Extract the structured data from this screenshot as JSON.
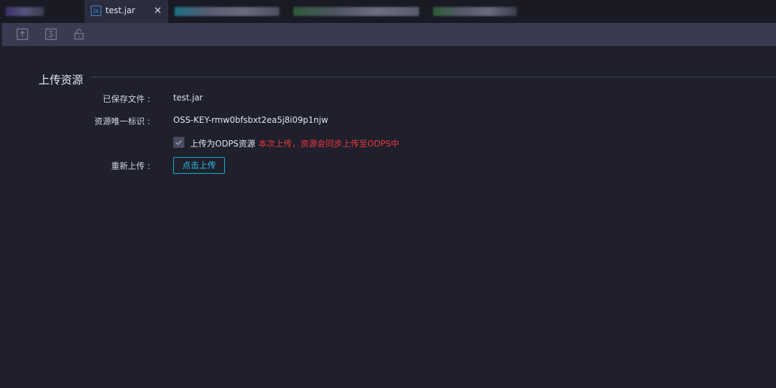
{
  "tabs": {
    "active": {
      "title": "test.jar",
      "icon_text": "Ja",
      "close_glyph": "×"
    }
  },
  "toolbar": {
    "icons": [
      "upload-icon",
      "version-icon",
      "unlock-icon"
    ]
  },
  "section": {
    "title": "上传资源"
  },
  "form": {
    "saved_file_label": "已保存文件 :",
    "saved_file_value": "test.jar",
    "resource_id_label": "资源唯一标识 :",
    "resource_id_value": "OSS-KEY-rmw0bfsbxt2ea5j8i09p1njw",
    "odps_checkbox_label": "上传为ODPS资源",
    "odps_checkbox_checked": true,
    "odps_hint": "本次上传，资源会同步上传至ODPS中",
    "reupload_label": "重新上传 :",
    "reupload_button": "点击上传"
  },
  "colors": {
    "background": "#1f202c",
    "toolbar": "#3a3b51",
    "accent": "#1bb3d4",
    "warning": "#e8363f"
  }
}
